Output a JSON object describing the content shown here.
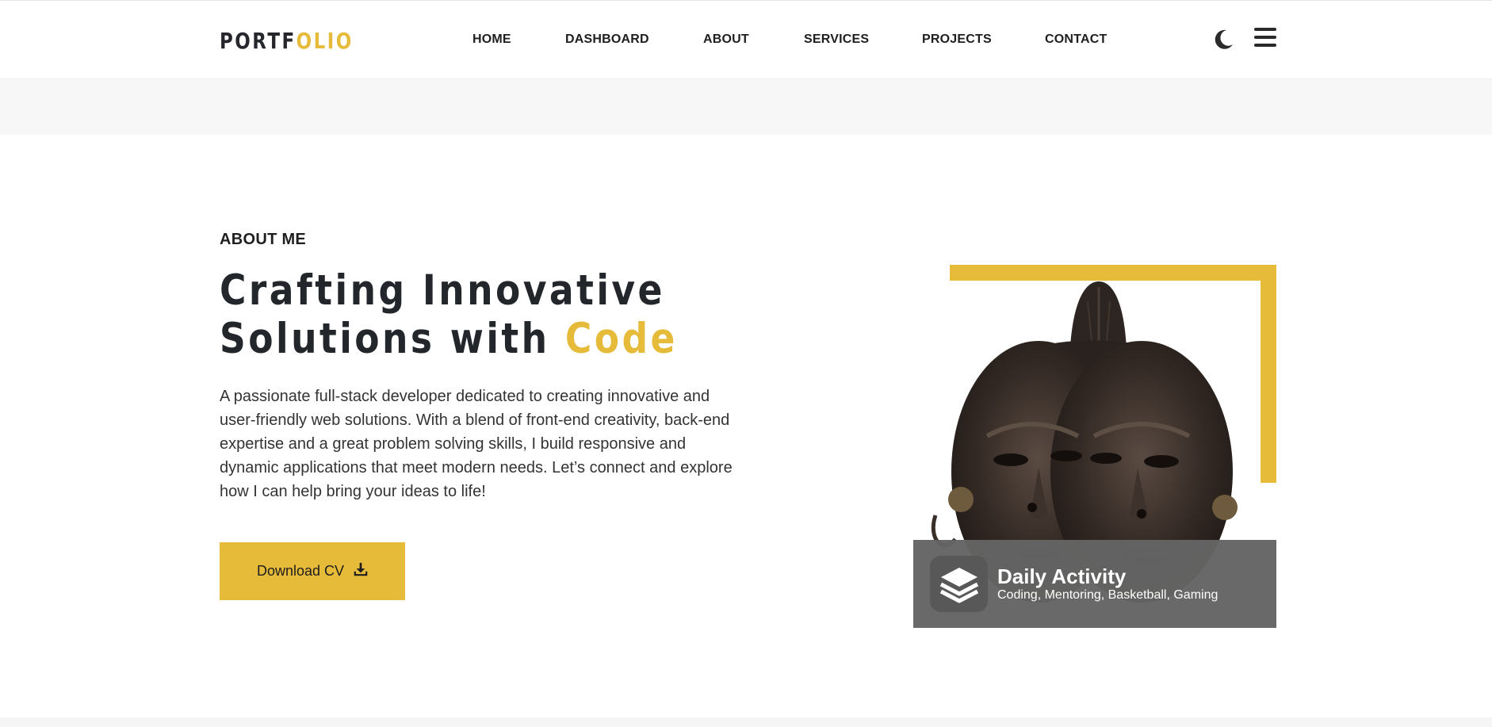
{
  "header": {
    "logo": {
      "part1": "PORTF",
      "part2": "OLIO"
    },
    "nav": [
      {
        "label": "HOME"
      },
      {
        "label": "DASHBOARD"
      },
      {
        "label": "ABOUT"
      },
      {
        "label": "SERVICES"
      },
      {
        "label": "PROJECTS"
      },
      {
        "label": "CONTACT"
      }
    ],
    "theme_icon": "moon-icon",
    "menu_icon": "hamburger-menu-icon"
  },
  "about": {
    "eyebrow": "ABOUT ME",
    "headline_line1": "Crafting Innovative",
    "headline_line2_prefix": "Solutions with ",
    "headline_accent": "Code",
    "description": "A passionate full-stack developer dedicated to creating innovative and user-friendly web solutions. With a blend of front-end creativity, back-end expertise and a great problem solving skills, I build responsive and dynamic applications that meet modern needs. Let’s connect and explore how I can help bring your ideas to life!",
    "cv_button": {
      "label": "Download CV",
      "icon": "download-icon"
    }
  },
  "activity_card": {
    "title": "Daily Activity",
    "subtitle": "Coding, Mentoring, Basketball, Gaming",
    "icon": "layers-icon"
  },
  "colors": {
    "accent": "#e6bb3a",
    "dark_text": "#23262b",
    "card_bg": "#646464"
  }
}
